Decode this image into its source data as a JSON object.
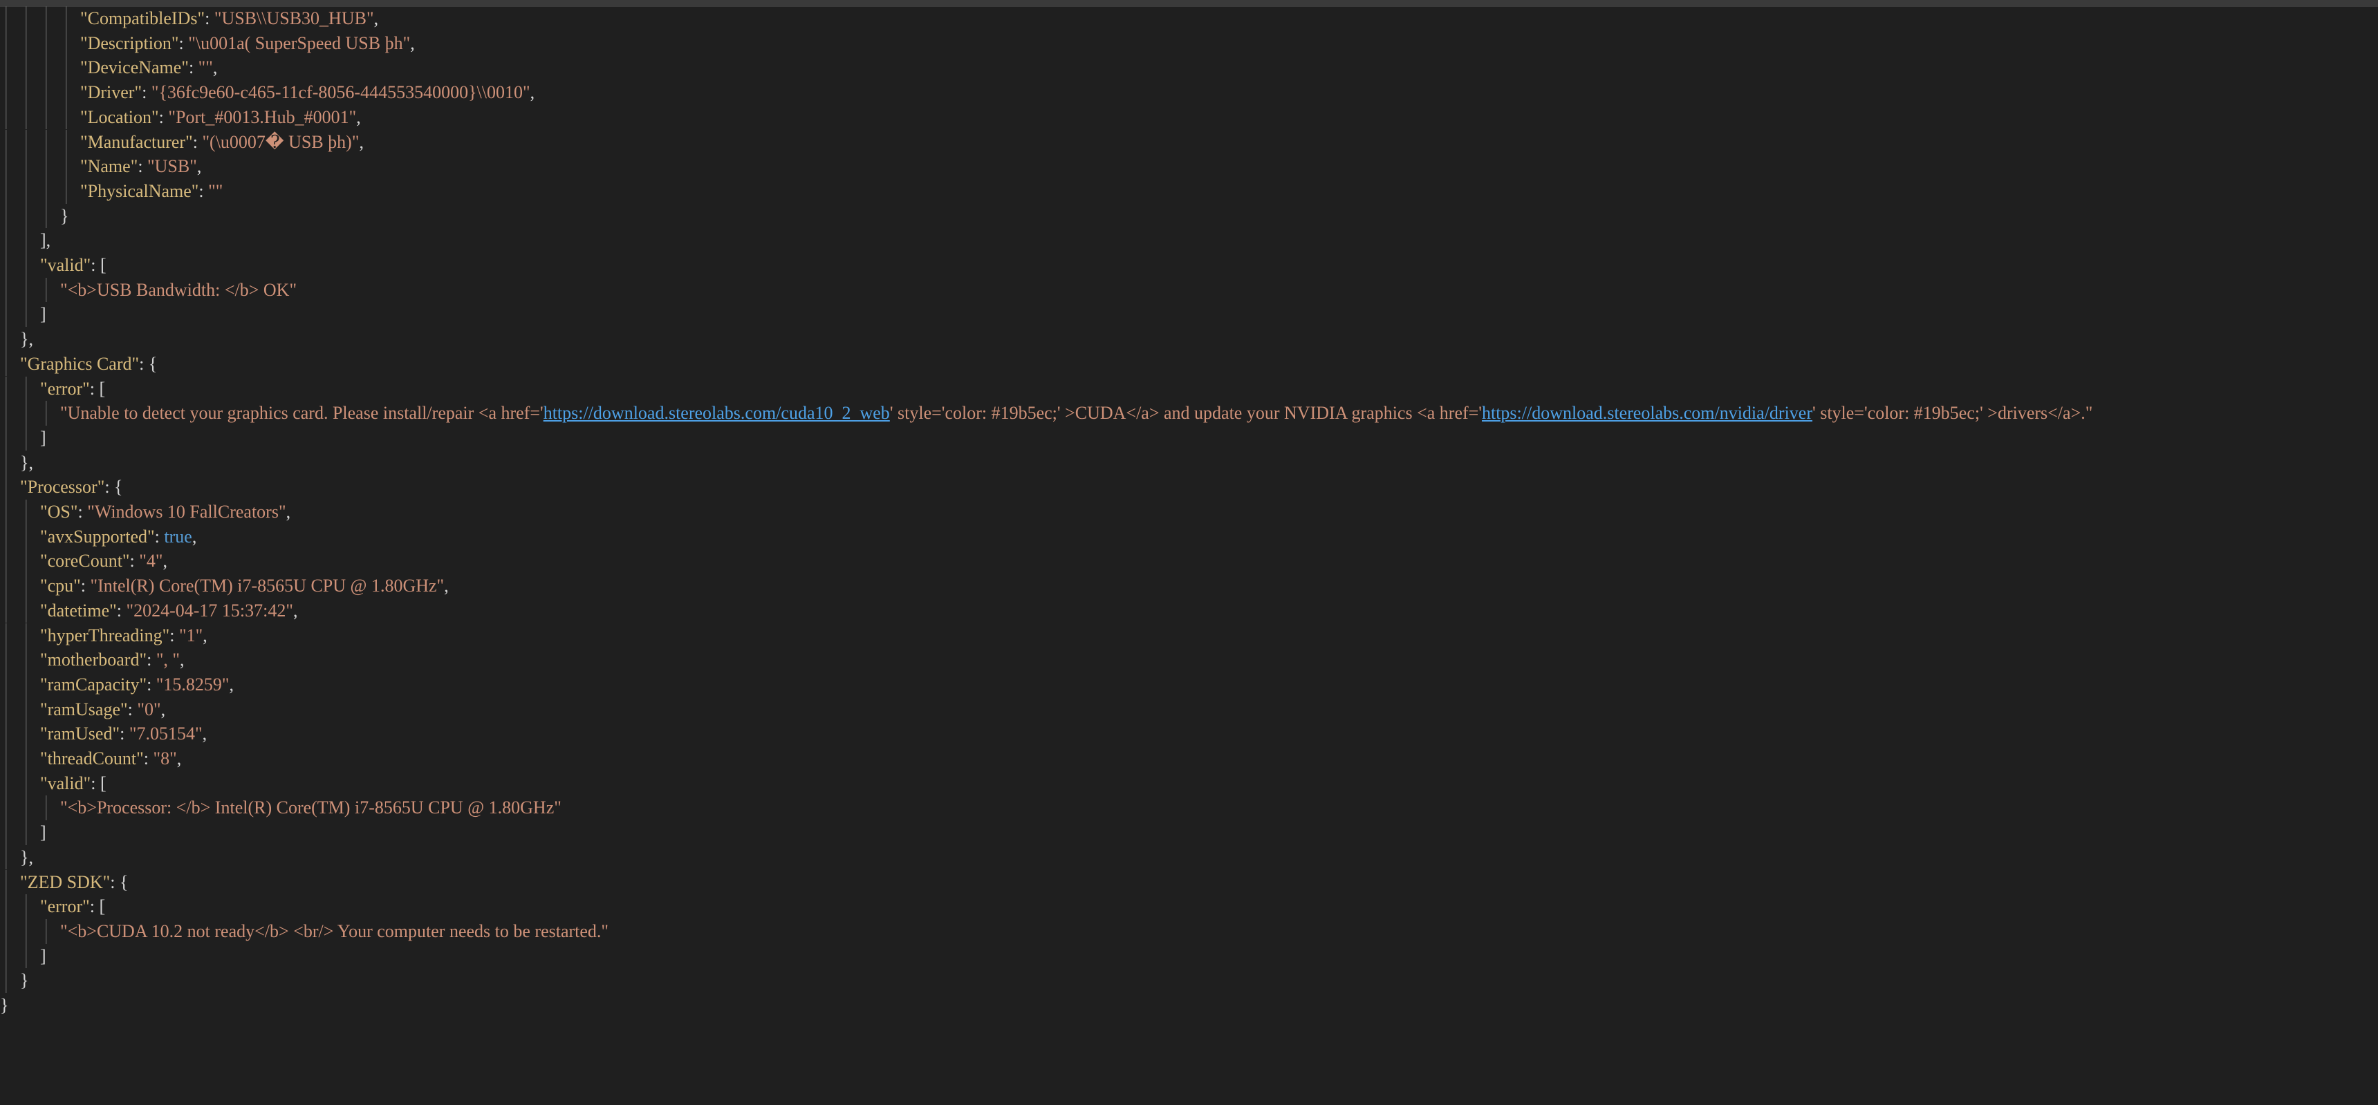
{
  "editor": {
    "lines": [
      {
        "indent": 4,
        "parts": [
          {
            "t": "\"CompatibleIDs\"",
            "c": "k"
          },
          {
            "t": ": ",
            "c": "p"
          },
          {
            "t": "\"USB\\\\USB30_HUB\"",
            "c": "s"
          },
          {
            "t": ",",
            "c": "p"
          }
        ]
      },
      {
        "indent": 4,
        "parts": [
          {
            "t": "\"Description\"",
            "c": "k"
          },
          {
            "t": ": ",
            "c": "p"
          },
          {
            "t": "\"\\u001a( SuperSpeed USB þh\"",
            "c": "s"
          },
          {
            "t": ",",
            "c": "p"
          }
        ]
      },
      {
        "indent": 4,
        "parts": [
          {
            "t": "\"DeviceName\"",
            "c": "k"
          },
          {
            "t": ": ",
            "c": "p"
          },
          {
            "t": "\"\"",
            "c": "s"
          },
          {
            "t": ",",
            "c": "p"
          }
        ]
      },
      {
        "indent": 4,
        "parts": [
          {
            "t": "\"Driver\"",
            "c": "k"
          },
          {
            "t": ": ",
            "c": "p"
          },
          {
            "t": "\"{36fc9e60-c465-11cf-8056-444553540000}\\\\0010\"",
            "c": "s"
          },
          {
            "t": ",",
            "c": "p"
          }
        ]
      },
      {
        "indent": 4,
        "parts": [
          {
            "t": "\"Location\"",
            "c": "k"
          },
          {
            "t": ": ",
            "c": "p"
          },
          {
            "t": "\"Port_#0013.Hub_#0001\"",
            "c": "s"
          },
          {
            "t": ",",
            "c": "p"
          }
        ]
      },
      {
        "indent": 4,
        "parts": [
          {
            "t": "\"Manufacturer\"",
            "c": "k"
          },
          {
            "t": ": ",
            "c": "p"
          },
          {
            "t": "\"(\\u0007� USB þh)\"",
            "c": "s"
          },
          {
            "t": ",",
            "c": "p"
          }
        ]
      },
      {
        "indent": 4,
        "parts": [
          {
            "t": "\"Name\"",
            "c": "k"
          },
          {
            "t": ": ",
            "c": "p"
          },
          {
            "t": "\"USB\"",
            "c": "s"
          },
          {
            "t": ",",
            "c": "p"
          }
        ]
      },
      {
        "indent": 4,
        "parts": [
          {
            "t": "\"PhysicalName\"",
            "c": "k"
          },
          {
            "t": ": ",
            "c": "p"
          },
          {
            "t": "\"\"",
            "c": "s"
          }
        ]
      },
      {
        "indent": 3,
        "parts": [
          {
            "t": "}",
            "c": "p"
          }
        ]
      },
      {
        "indent": 2,
        "parts": [
          {
            "t": "],",
            "c": "p"
          }
        ]
      },
      {
        "indent": 2,
        "parts": [
          {
            "t": "\"valid\"",
            "c": "k"
          },
          {
            "t": ": [",
            "c": "p"
          }
        ]
      },
      {
        "indent": 3,
        "parts": [
          {
            "t": "\"<b>USB Bandwidth: </b> OK\"",
            "c": "s"
          }
        ]
      },
      {
        "indent": 2,
        "parts": [
          {
            "t": "]",
            "c": "p"
          }
        ]
      },
      {
        "indent": 1,
        "parts": [
          {
            "t": "},",
            "c": "p"
          }
        ]
      },
      {
        "indent": 1,
        "parts": [
          {
            "t": "\"Graphics Card\"",
            "c": "k"
          },
          {
            "t": ": {",
            "c": "p"
          }
        ]
      },
      {
        "indent": 2,
        "parts": [
          {
            "t": "\"error\"",
            "c": "k"
          },
          {
            "t": ": [",
            "c": "p"
          }
        ]
      },
      {
        "indent": 3,
        "parts": [
          {
            "t": "\"Unable to detect your graphics card. Please install/repair <a href='",
            "c": "s"
          },
          {
            "t": "https://download.stereolabs.com/cuda10_2_web",
            "c": "lnk"
          },
          {
            "t": "' style='color: #19b5ec;' >CUDA</a> and update your NVIDIA graphics <a href='",
            "c": "s"
          },
          {
            "t": "https://download.stereolabs.com/nvidia/driver",
            "c": "lnk"
          },
          {
            "t": "' style='color: #19b5ec;' >drivers</a>.\"",
            "c": "s"
          }
        ]
      },
      {
        "indent": 2,
        "parts": [
          {
            "t": "]",
            "c": "p"
          }
        ]
      },
      {
        "indent": 1,
        "parts": [
          {
            "t": "},",
            "c": "p"
          }
        ]
      },
      {
        "indent": 1,
        "parts": [
          {
            "t": "\"Processor\"",
            "c": "k"
          },
          {
            "t": ": {",
            "c": "p"
          }
        ]
      },
      {
        "indent": 2,
        "parts": [
          {
            "t": "\"OS\"",
            "c": "k"
          },
          {
            "t": ": ",
            "c": "p"
          },
          {
            "t": "\"Windows 10 FallCreators\"",
            "c": "s"
          },
          {
            "t": ",",
            "c": "p"
          }
        ]
      },
      {
        "indent": 2,
        "parts": [
          {
            "t": "\"avxSupported\"",
            "c": "k"
          },
          {
            "t": ": ",
            "c": "p"
          },
          {
            "t": "true",
            "c": "b"
          },
          {
            "t": ",",
            "c": "p"
          }
        ]
      },
      {
        "indent": 2,
        "parts": [
          {
            "t": "\"coreCount\"",
            "c": "k"
          },
          {
            "t": ": ",
            "c": "p"
          },
          {
            "t": "\"4\"",
            "c": "s"
          },
          {
            "t": ",",
            "c": "p"
          }
        ]
      },
      {
        "indent": 2,
        "parts": [
          {
            "t": "\"cpu\"",
            "c": "k"
          },
          {
            "t": ": ",
            "c": "p"
          },
          {
            "t": "\"Intel(R) Core(TM) i7-8565U CPU @ 1.80GHz\"",
            "c": "s"
          },
          {
            "t": ",",
            "c": "p"
          }
        ]
      },
      {
        "indent": 2,
        "parts": [
          {
            "t": "\"datetime\"",
            "c": "k"
          },
          {
            "t": ": ",
            "c": "p"
          },
          {
            "t": "\"2024-04-17 15:37:42\"",
            "c": "s"
          },
          {
            "t": ",",
            "c": "p"
          }
        ]
      },
      {
        "indent": 2,
        "parts": [
          {
            "t": "\"hyperThreading\"",
            "c": "k"
          },
          {
            "t": ": ",
            "c": "p"
          },
          {
            "t": "\"1\"",
            "c": "s"
          },
          {
            "t": ",",
            "c": "p"
          }
        ]
      },
      {
        "indent": 2,
        "parts": [
          {
            "t": "\"motherboard\"",
            "c": "k"
          },
          {
            "t": ": ",
            "c": "p"
          },
          {
            "t": "\", \"",
            "c": "s"
          },
          {
            "t": ",",
            "c": "p"
          }
        ]
      },
      {
        "indent": 2,
        "parts": [
          {
            "t": "\"ramCapacity\"",
            "c": "k"
          },
          {
            "t": ": ",
            "c": "p"
          },
          {
            "t": "\"15.8259\"",
            "c": "s"
          },
          {
            "t": ",",
            "c": "p"
          }
        ]
      },
      {
        "indent": 2,
        "parts": [
          {
            "t": "\"ramUsage\"",
            "c": "k"
          },
          {
            "t": ": ",
            "c": "p"
          },
          {
            "t": "\"0\"",
            "c": "s"
          },
          {
            "t": ",",
            "c": "p"
          }
        ]
      },
      {
        "indent": 2,
        "parts": [
          {
            "t": "\"ramUsed\"",
            "c": "k"
          },
          {
            "t": ": ",
            "c": "p"
          },
          {
            "t": "\"7.05154\"",
            "c": "s"
          },
          {
            "t": ",",
            "c": "p"
          }
        ]
      },
      {
        "indent": 2,
        "parts": [
          {
            "t": "\"threadCount\"",
            "c": "k"
          },
          {
            "t": ": ",
            "c": "p"
          },
          {
            "t": "\"8\"",
            "c": "s"
          },
          {
            "t": ",",
            "c": "p"
          }
        ]
      },
      {
        "indent": 2,
        "parts": [
          {
            "t": "\"valid\"",
            "c": "k"
          },
          {
            "t": ": [",
            "c": "p"
          }
        ]
      },
      {
        "indent": 3,
        "parts": [
          {
            "t": "\"<b>Processor: </b> Intel(R) Core(TM) i7-8565U CPU @ 1.80GHz\"",
            "c": "s"
          }
        ]
      },
      {
        "indent": 2,
        "parts": [
          {
            "t": "]",
            "c": "p"
          }
        ]
      },
      {
        "indent": 1,
        "parts": [
          {
            "t": "},",
            "c": "p"
          }
        ]
      },
      {
        "indent": 1,
        "parts": [
          {
            "t": "\"ZED SDK\"",
            "c": "k"
          },
          {
            "t": ": {",
            "c": "p"
          }
        ]
      },
      {
        "indent": 2,
        "parts": [
          {
            "t": "\"error\"",
            "c": "k"
          },
          {
            "t": ": [",
            "c": "p"
          }
        ]
      },
      {
        "indent": 3,
        "parts": [
          {
            "t": "\"<b>CUDA 10.2 not ready</b> <br/> Your computer needs to be restarted.\"",
            "c": "s"
          }
        ]
      },
      {
        "indent": 2,
        "parts": [
          {
            "t": "]",
            "c": "p"
          }
        ]
      },
      {
        "indent": 1,
        "parts": [
          {
            "t": "}",
            "c": "p"
          }
        ]
      },
      {
        "indent": 0,
        "parts": [
          {
            "t": "}",
            "c": "p"
          }
        ]
      }
    ]
  }
}
